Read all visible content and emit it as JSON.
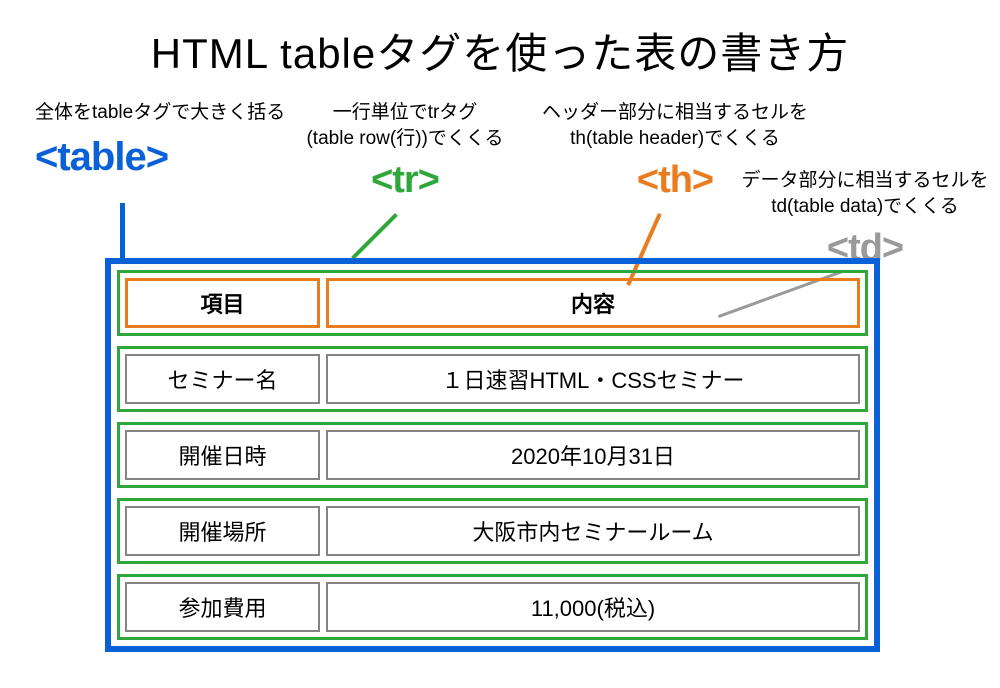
{
  "title": "HTML tableタグを使った表の書き方",
  "annotations": {
    "table": {
      "desc": "全体をtableタグで大きく括る",
      "tag": "<table>"
    },
    "tr": {
      "desc1": "一行単位でtrタグ",
      "desc2": "(table row(行))でくくる",
      "tag": "<tr>"
    },
    "th": {
      "desc1": "ヘッダー部分に相当するセルを",
      "desc2": "th(table header)でくくる",
      "tag": "<th>"
    },
    "td": {
      "desc1": "データ部分に相当するセルを",
      "desc2": "td(table data)でくくる",
      "tag": "<td>"
    }
  },
  "table": {
    "headers": {
      "col1": "項目",
      "col2": "内容"
    },
    "rows": [
      {
        "col1": "セミナー名",
        "col2": "１日速習HTML・CSSセミナー"
      },
      {
        "col1": "開催日時",
        "col2": "2020年10月31日"
      },
      {
        "col1": "開催場所",
        "col2": "大阪市内セミナールーム"
      },
      {
        "col1": "参加費用",
        "col2": "11,000(税込)"
      }
    ]
  }
}
